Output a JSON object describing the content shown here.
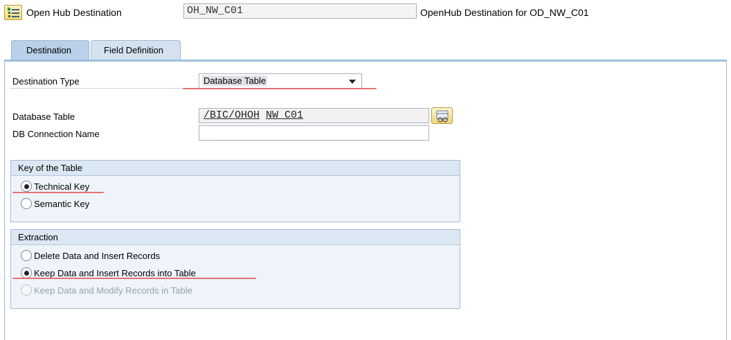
{
  "header": {
    "icon": "open-hub-destination-icon",
    "label": "Open Hub Destination",
    "id_value": "OH_NW_C01",
    "description": "OpenHub Destination for OD_NW_C01"
  },
  "tabs": [
    {
      "label": "Destination",
      "selected": true
    },
    {
      "label": "Field Definition",
      "selected": false
    }
  ],
  "form": {
    "destination_type_label": "Destination Type",
    "destination_type_value": "Database Table",
    "database_table_label": "Database Table",
    "database_table_prefix": "/BIC/OHOH",
    "database_table_suffix": "NW C01",
    "db_connection_label": "DB Connection Name",
    "db_connection_value": ""
  },
  "key_group": {
    "title": "Key of the Table",
    "options": [
      {
        "label": "Technical Key",
        "selected": true,
        "disabled": false
      },
      {
        "label": "Semantic Key",
        "selected": false,
        "disabled": false
      }
    ]
  },
  "extraction_group": {
    "title": "Extraction",
    "options": [
      {
        "label": "Delete Data and Insert Records",
        "selected": false,
        "disabled": false
      },
      {
        "label": "Keep Data and Insert Records into Table",
        "selected": true,
        "disabled": false
      },
      {
        "label": "Keep Data and Modify Records in Table",
        "selected": false,
        "disabled": true
      }
    ]
  },
  "colors": {
    "tab_active": "#b9d0e8",
    "group_header": "#dbe7f3",
    "annotation_underline": "#e35a5a"
  }
}
